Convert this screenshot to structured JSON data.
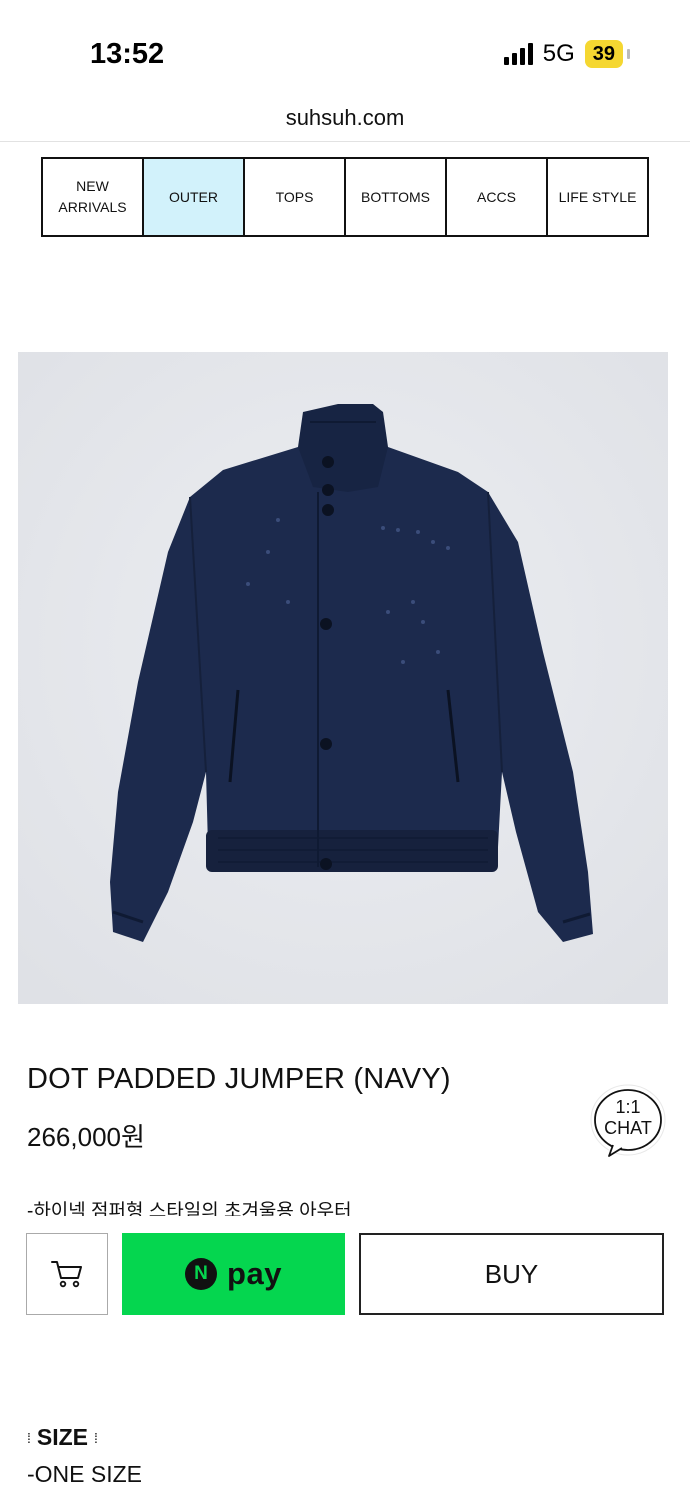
{
  "status_bar": {
    "time": "13:52",
    "network": "5G",
    "battery": "39"
  },
  "url_bar": {
    "url": "suhsuh.com"
  },
  "categories": [
    {
      "line1": "NEW",
      "line2": "ARRIVALS",
      "active": false
    },
    {
      "line1": "OUTER",
      "line2": "",
      "active": true
    },
    {
      "line1": "TOPS",
      "line2": "",
      "active": false
    },
    {
      "line1": "BOTTOMS",
      "line2": "",
      "active": false
    },
    {
      "line1": "ACCS",
      "line2": "",
      "active": false
    },
    {
      "line1": "LIFE STYLE",
      "line2": "",
      "active": false
    }
  ],
  "product": {
    "name": "DOT PADDED JUMPER (NAVY)",
    "price": "266,000원",
    "description": "-하이넥 점퍼형 스타일의 초겨울용 아우터",
    "image_icon": "navy-padded-jumper-photo"
  },
  "chat": {
    "line1": "1:1",
    "line2": "CHAT"
  },
  "purchase": {
    "cart_icon": "cart-icon",
    "npay_badge": "N",
    "npay_label": "pay",
    "buy_label": "BUY"
  },
  "size": {
    "heading": "SIZE",
    "value": "-ONE SIZE"
  },
  "colors": {
    "active_tab": "#d2f2fb",
    "npay_green": "#05d64f",
    "jacket_navy": "#1c2a4d"
  }
}
